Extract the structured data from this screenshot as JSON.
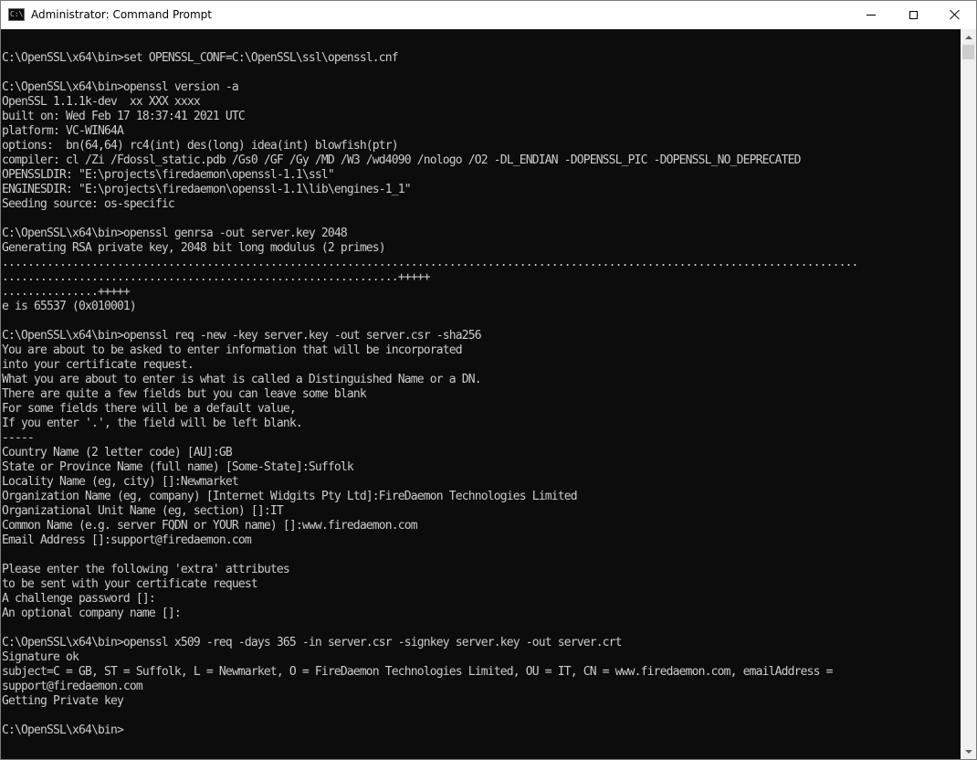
{
  "window": {
    "title": "Administrator: Command Prompt",
    "icon": "cmd-icon",
    "controls": [
      "minimize-icon",
      "maximize-icon",
      "close-icon"
    ]
  },
  "console": {
    "background": "#0c0c0c",
    "foreground": "#cccccc",
    "lines": [
      "",
      "C:\\OpenSSL\\x64\\bin>set OPENSSL_CONF=C:\\OpenSSL\\ssl\\openssl.cnf",
      "",
      "C:\\OpenSSL\\x64\\bin>openssl version -a",
      "OpenSSL 1.1.1k-dev  xx XXX xxxx",
      "built on: Wed Feb 17 18:37:41 2021 UTC",
      "platform: VC-WIN64A",
      "options:  bn(64,64) rc4(int) des(long) idea(int) blowfish(ptr)",
      "compiler: cl /Zi /Fdossl_static.pdb /Gs0 /GF /Gy /MD /W3 /wd4090 /nologo /O2 -DL_ENDIAN -DOPENSSL_PIC -DOPENSSL_NO_DEPRECATED",
      "OPENSSLDIR: \"E:\\projects\\firedaemon\\openssl-1.1\\ssl\"",
      "ENGINESDIR: \"E:\\projects\\firedaemon\\openssl-1.1\\lib\\engines-1_1\"",
      "Seeding source: os-specific",
      "",
      "C:\\OpenSSL\\x64\\bin>openssl genrsa -out server.key 2048",
      "Generating RSA private key, 2048 bit long modulus (2 primes)",
      "......................................................................................................................................",
      "..............................................................+++++",
      "...............+++++",
      "e is 65537 (0x010001)",
      "",
      "C:\\OpenSSL\\x64\\bin>openssl req -new -key server.key -out server.csr -sha256",
      "You are about to be asked to enter information that will be incorporated",
      "into your certificate request.",
      "What you are about to enter is what is called a Distinguished Name or a DN.",
      "There are quite a few fields but you can leave some blank",
      "For some fields there will be a default value,",
      "If you enter '.', the field will be left blank.",
      "-----",
      "Country Name (2 letter code) [AU]:GB",
      "State or Province Name (full name) [Some-State]:Suffolk",
      "Locality Name (eg, city) []:Newmarket",
      "Organization Name (eg, company) [Internet Widgits Pty Ltd]:FireDaemon Technologies Limited",
      "Organizational Unit Name (eg, section) []:IT",
      "Common Name (e.g. server FQDN or YOUR name) []:www.firedaemon.com",
      "Email Address []:support@firedaemon.com",
      "",
      "Please enter the following 'extra' attributes",
      "to be sent with your certificate request",
      "A challenge password []:",
      "An optional company name []:",
      "",
      "C:\\OpenSSL\\x64\\bin>openssl x509 -req -days 365 -in server.csr -signkey server.key -out server.crt",
      "Signature ok",
      "subject=C = GB, ST = Suffolk, L = Newmarket, O = FireDaemon Technologies Limited, OU = IT, CN = www.firedaemon.com, emailAddress =",
      "support@firedaemon.com",
      "Getting Private key",
      "",
      "C:\\OpenSSL\\x64\\bin>"
    ]
  },
  "scrollbar": {
    "up_icon": "scroll-up-arrow-icon",
    "down_icon": "scroll-down-arrow-icon"
  }
}
